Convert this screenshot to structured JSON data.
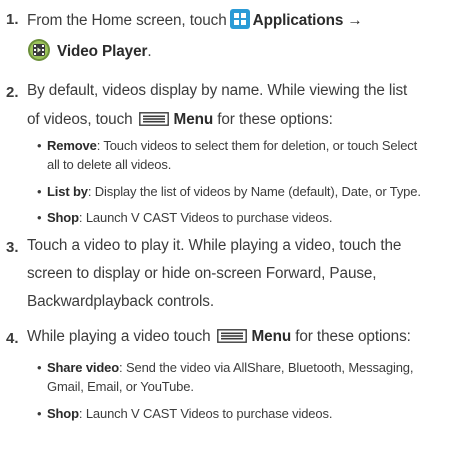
{
  "steps": [
    {
      "number": "1.",
      "line1_pre": "From the Home screen, touch",
      "line1_bold": "Applications →",
      "line2_bold": "Video Player",
      "line2_post": "."
    },
    {
      "number": "2.",
      "line1": "By default, videos display by name. While viewing the list",
      "line2_pre": "of videos, touch",
      "line2_bold": "Menu",
      "line2_post": " for these options:",
      "bullets": [
        {
          "term": "Remove",
          "line1_rest": ": Touch videos to select them for deletion, or touch Select",
          "line2": "all to delete all videos."
        },
        {
          "term": "List by",
          "line1_rest": ": Display the list of videos by Name (default), Date, or Type."
        },
        {
          "term": "Shop",
          "line1_rest": ": Launch V CAST Videos to purchase videos."
        }
      ]
    },
    {
      "number": "3.",
      "line1": "Touch a video to play it. While playing a video, touch the",
      "line2": "screen to display or hide on-screen Forward, Pause,",
      "line3": "Backwardplayback controls."
    },
    {
      "number": "4.",
      "line1_pre": "While playing a video touch",
      "line1_bold": "Menu",
      "line1_post": " for these options:",
      "bullets": [
        {
          "term": "Share video",
          "line1_rest": ": Send the video via AllShare, Bluetooth, Messaging,",
          "line2": "Gmail, Email, or YouTube."
        },
        {
          "term": "Shop",
          "line1_rest": ": Launch V CAST Videos to purchase videos."
        }
      ]
    }
  ],
  "icons": {
    "applications": "applications-grid-icon",
    "video_player": "video-player-icon",
    "menu": "menu-key-icon"
  },
  "colors": {
    "text": "#3c3c3c",
    "apps_icon_bg": "#2b9bd6"
  }
}
